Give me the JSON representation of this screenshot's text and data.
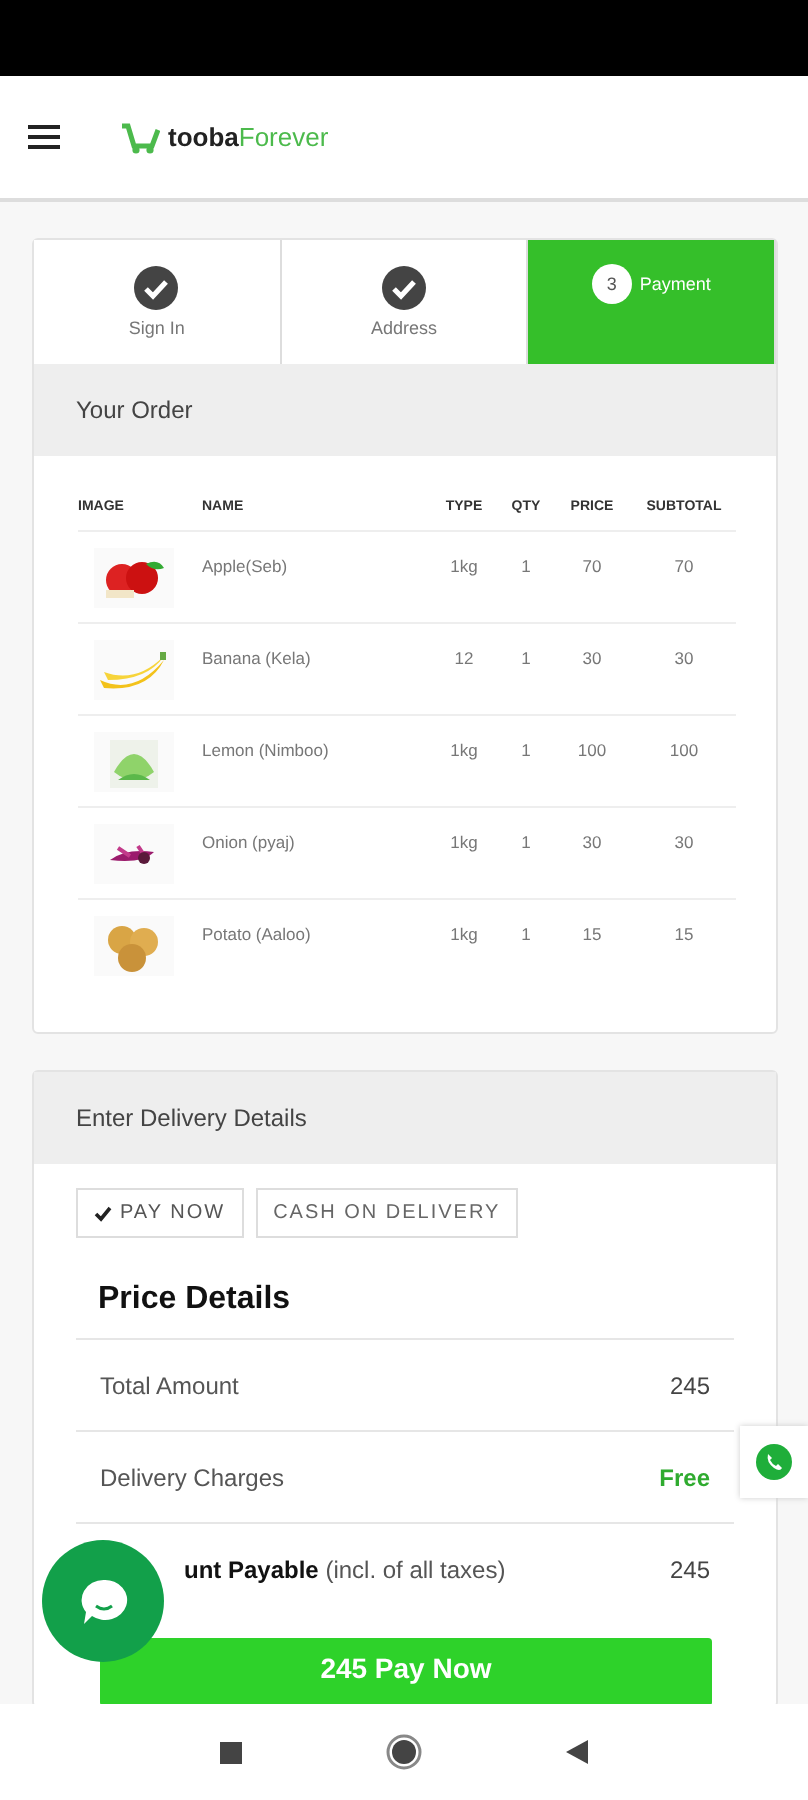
{
  "brand": {
    "first": "tooba",
    "second": "Forever"
  },
  "steps": [
    {
      "label": "Sign In",
      "kind": "done",
      "selected": false
    },
    {
      "label": "Address",
      "kind": "done",
      "selected": false
    },
    {
      "number": "3",
      "label": "Payment",
      "kind": "current",
      "selected": true
    }
  ],
  "order": {
    "title": "Your Order",
    "columns": [
      "IMAGE",
      "NAME",
      "TYPE",
      "QTY",
      "PRICE",
      "SUBTOTAL"
    ],
    "rows": [
      {
        "kind": "picture",
        "name": "Apple(Seb)",
        "type": "1kg",
        "qty": "1",
        "price": "70",
        "subtotal": "70"
      },
      {
        "kind": "picture",
        "name": "Banana (Kela)",
        "type": "12",
        "qty": "1",
        "price": "30",
        "subtotal": "30"
      },
      {
        "kind": "picture",
        "name": "Lemon (Nimboo)",
        "type": "1kg",
        "qty": "1",
        "price": "100",
        "subtotal": "100"
      },
      {
        "kind": "picture",
        "name": "Onion (pyaj)",
        "type": "1kg",
        "qty": "1",
        "price": "30",
        "subtotal": "30"
      },
      {
        "kind": "picture",
        "name": "Potato (Aaloo)",
        "type": "1kg",
        "qty": "1",
        "price": "15",
        "subtotal": "15"
      }
    ]
  },
  "delivery": {
    "title": "Enter Delivery Details",
    "payment_options": [
      {
        "label": "PAY NOW",
        "selected": true
      },
      {
        "label": "CASH ON DELIVERY",
        "selected": false
      }
    ],
    "price_title": "Price Details",
    "price_rows": [
      {
        "label": "Total Amount",
        "value": "245",
        "kind": "plain"
      },
      {
        "label": "Delivery Charges",
        "value": "Free",
        "kind": "free"
      },
      {
        "label": "**unt Payable** (incl. of all taxes)",
        "value": "245",
        "kind": "plain"
      }
    ],
    "pay_button": "245 Pay Now"
  }
}
